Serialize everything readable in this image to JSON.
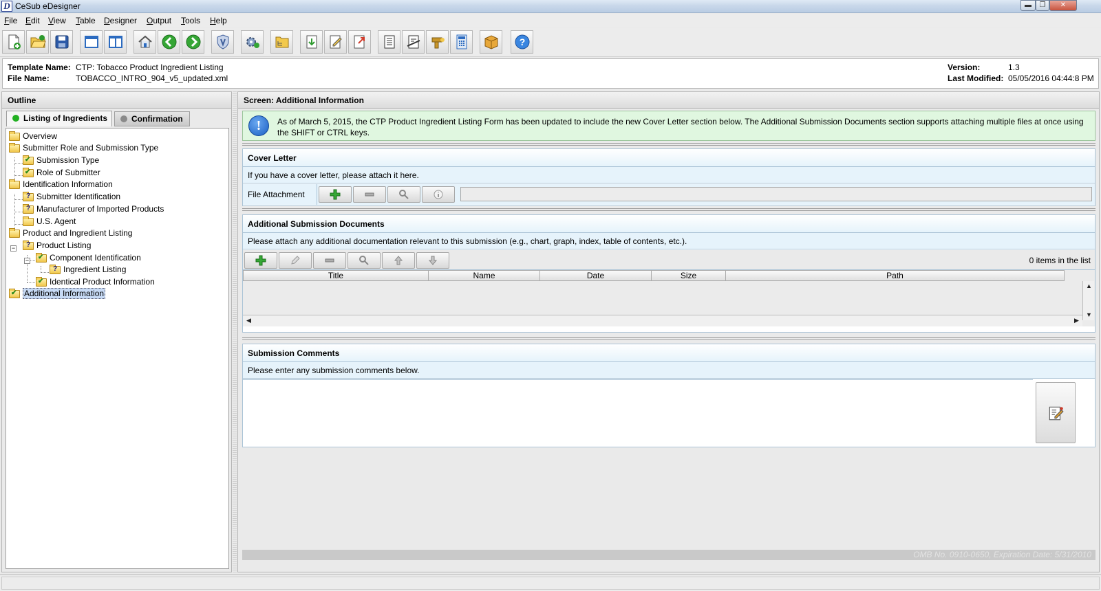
{
  "window": {
    "title": "CeSub eDesigner",
    "app_icon_letter": "D",
    "controls": [
      "minimize",
      "maximize",
      "close"
    ]
  },
  "menu": [
    {
      "label": "File",
      "accel": "F"
    },
    {
      "label": "Edit",
      "accel": "E"
    },
    {
      "label": "View",
      "accel": "V"
    },
    {
      "label": "Table",
      "accel": "T"
    },
    {
      "label": "Designer",
      "accel": "D"
    },
    {
      "label": "Output",
      "accel": "O"
    },
    {
      "label": "Tools",
      "accel": "T"
    },
    {
      "label": "Help",
      "accel": "H"
    }
  ],
  "toolbar": {
    "buttons": [
      "new-doc-icon",
      "open-folder-icon",
      "save-icon",
      "window-icon",
      "split-view-icon",
      "home-icon",
      "back-arrow-icon",
      "forward-arrow-icon",
      "shield-icon",
      "gears-icon",
      "folder-tree-icon",
      "import-icon",
      "edit-doc-icon",
      "export-icon",
      "list-doc-icon",
      "ruler-doc-icon",
      "tools-icon",
      "calculator-icon",
      "package-icon",
      "help-icon"
    ]
  },
  "header": {
    "template_label": "Template Name:",
    "template_value": "CTP: Tobacco Product Ingredient Listing",
    "file_label": "File Name:",
    "file_value": "TOBACCO_INTRO_904_v5_updated.xml",
    "version_label": "Version:",
    "version_value": "1.3",
    "modified_label": "Last Modified:",
    "modified_value": "05/05/2016 04:44:8 PM"
  },
  "outline": {
    "title": "Outline",
    "tabs": [
      {
        "label": "Listing of Ingredients",
        "status_color": "#22b022",
        "active": true
      },
      {
        "label": "Confirmation",
        "status_color": "#8a8a8a",
        "active": false
      }
    ],
    "tree": [
      {
        "label": "Overview",
        "icon": "folder",
        "status": "none",
        "level": 0
      },
      {
        "label": "Submitter Role and Submission Type",
        "icon": "folder",
        "status": "none",
        "level": 0
      },
      {
        "label": "Submission Type",
        "icon": "folder",
        "status": "complete",
        "level": 1
      },
      {
        "label": "Role of Submitter",
        "icon": "folder",
        "status": "complete",
        "level": 1
      },
      {
        "label": "Identification Information",
        "icon": "folder",
        "status": "none",
        "level": 0
      },
      {
        "label": "Submitter Identification",
        "icon": "folder",
        "status": "incomplete",
        "level": 1
      },
      {
        "label": "Manufacturer of Imported Products",
        "icon": "folder",
        "status": "incomplete",
        "level": 1
      },
      {
        "label": "U.S. Agent",
        "icon": "folder",
        "status": "none",
        "level": 1
      },
      {
        "label": "Product and Ingredient Listing",
        "icon": "folder",
        "status": "none",
        "level": 0
      },
      {
        "label": "Product Listing",
        "icon": "folder",
        "status": "incomplete",
        "level": 1
      },
      {
        "label": "Component Identification",
        "icon": "folder",
        "status": "complete",
        "level": 2
      },
      {
        "label": "Ingredient Listing",
        "icon": "folder",
        "status": "incomplete",
        "level": 3
      },
      {
        "label": "Identical Product Information",
        "icon": "folder",
        "status": "complete",
        "level": 2
      },
      {
        "label": "Additional Information",
        "icon": "folder",
        "status": "complete",
        "level": 0,
        "selected": true
      }
    ]
  },
  "screen": {
    "title": "Screen: Additional Information",
    "notice": "As of March 5, 2015, the CTP Product Ingredient Listing Form has been updated to include the new Cover Letter section below. The Additional Submission Documents section supports attaching multiple files at once using the SHIFT or CTRL keys.",
    "cover_letter": {
      "title": "Cover Letter",
      "desc": "If you have a cover letter, please attach it here.",
      "field_label": "File Attachment",
      "field_value": ""
    },
    "additional_docs": {
      "title": "Additional Submission Documents",
      "desc": "Please attach any additional documentation relevant to this submission (e.g., chart, graph, index, table of contents, etc.).",
      "count_text": "0 items in the list",
      "columns": [
        "Title",
        "Name",
        "Date",
        "Size",
        "Path"
      ],
      "rows": []
    },
    "comments": {
      "title": "Submission Comments",
      "desc": "Please enter any submission comments below.",
      "value": ""
    },
    "footer": "OMB No. 0910-0650, Expiration Date: 5/31/2010"
  },
  "status_bar": ""
}
